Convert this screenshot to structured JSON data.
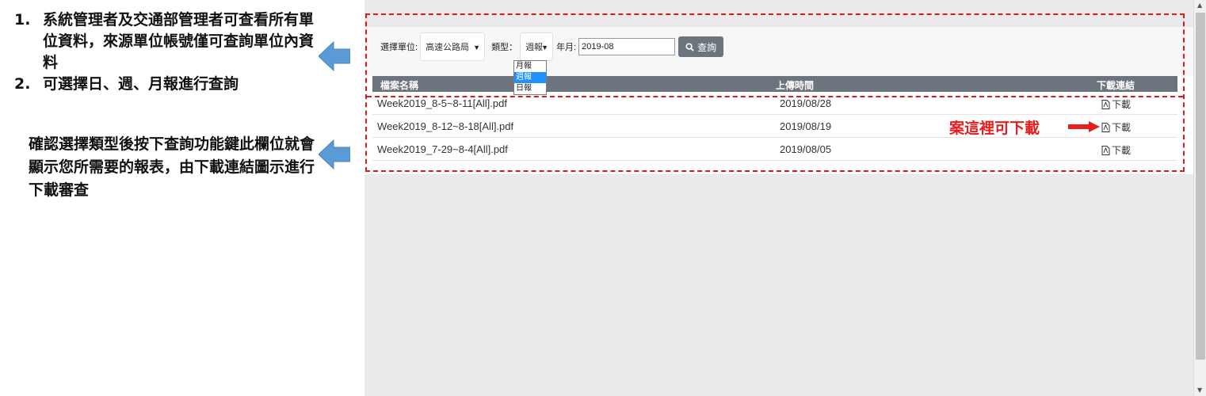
{
  "annotations": {
    "list": [
      {
        "num": "1.",
        "text": "系統管理者及交通部管理者可查看所有單位資料，來源單位帳號僅可查詢單位內資料"
      },
      {
        "num": "2.",
        "text": "可選擇日、週、月報進行查詢"
      }
    ],
    "paragraph": "確認選擇類型後按下查詢功能鍵此欄位就會顯示您所需要的報表，由下載連結圖示進行下載審查",
    "download_hint": "案這裡可下載",
    "arrow_color": "#5b9bd5",
    "highlight_color": "#e01818"
  },
  "filters": {
    "unit_label": "選擇單位:",
    "unit_value": "高速公路局",
    "type_label": "類型：",
    "type_value": "週報",
    "type_options": [
      "月報",
      "週報",
      "日報"
    ],
    "date_label": "年月:",
    "date_value": "2019-08",
    "query_button": "查詢"
  },
  "table": {
    "headers": {
      "name": "檔案名稱",
      "time": "上傳時間",
      "link": "下載連結"
    },
    "rows": [
      {
        "name": "Week2019_8-5~8-11[All].pdf",
        "time": "2019/08/28",
        "link": "下載"
      },
      {
        "name": "Week2019_8-12~8-18[All].pdf",
        "time": "2019/08/19",
        "link": "下載"
      },
      {
        "name": "Week2019_7-29~8-4[All].pdf",
        "time": "2019/08/05",
        "link": "下載"
      }
    ]
  }
}
